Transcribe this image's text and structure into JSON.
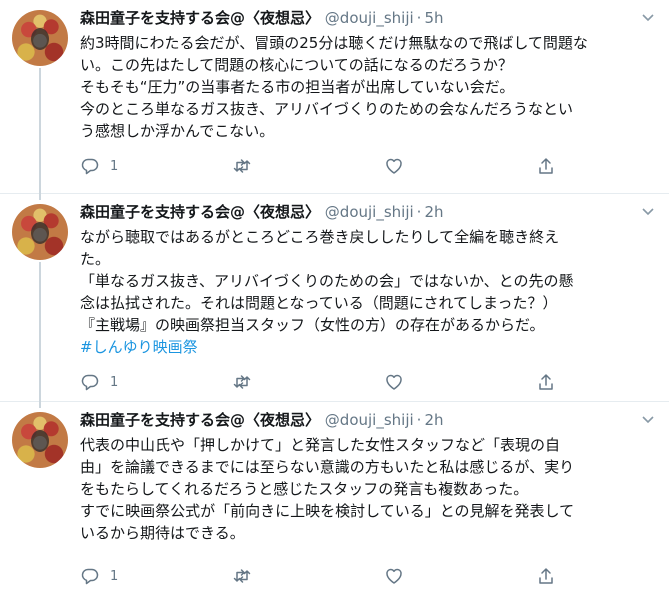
{
  "tweets": [
    {
      "name": "森田童子を支持する会@〈夜想忌〉",
      "handle": "@douji_shiji",
      "dot": "·",
      "time": "5h",
      "lines": [
        "約3時間にわたる会だが、冒頭の25分は聴くだけ無駄なので飛ばして問題な",
        "い。この先はたして問題の核心についての話になるのだろうか？",
        "そもそも“圧力”の当事者たる市の担当者が出席していない会だ。",
        "今のところ単なるガス抜き、アリバイづくりのための会なんだろうなとい",
        "う感想しか浮かんでこない。"
      ],
      "reply_count": "1",
      "retweet_count": "",
      "like_count": ""
    },
    {
      "name": "森田童子を支持する会@〈夜想忌〉",
      "handle": "@douji_shiji",
      "dot": "·",
      "time": "2h",
      "lines": [
        "ながら聴取ではあるがところどころ巻き戻ししたりして全編を聴き終え",
        "た。",
        "「単なるガス抜き、アリバイづくりのための会」ではないか、との先の懸",
        "念は払拭された。それは問題となっている（問題にされてしまった？）",
        "『主戦場』の映画祭担当スタッフ（女性の方）の存在があるからだ。"
      ],
      "hashtag": "#しんゆり映画祭",
      "reply_count": "1",
      "retweet_count": "",
      "like_count": ""
    },
    {
      "name": "森田童子を支持する会@〈夜想忌〉",
      "handle": "@douji_shiji",
      "dot": "·",
      "time": "2h",
      "lines": [
        "代表の中山氏や「押しかけて」と発言した女性スタッフなど「表現の自",
        "由」を論議できるまでには至らない意識の方もいたと私は感じるが、実り",
        "をもたらしてくれるだろうと感じたスタッフの発言も複数あった。",
        "すでに映画祭公式が「前向きに上映を検討している」との見解を発表して",
        "いるから期待はできる。"
      ],
      "reply_count": "1",
      "retweet_count": "",
      "like_count": ""
    }
  ],
  "icons": {
    "reply": "reply-icon",
    "retweet": "retweet-icon",
    "like": "heart-icon",
    "share": "share-icon",
    "more": "chevron-down-icon"
  },
  "colors": {
    "link": "#1b95e0",
    "secondary_text": "#657786",
    "thread_line": "#ccd6dd"
  }
}
